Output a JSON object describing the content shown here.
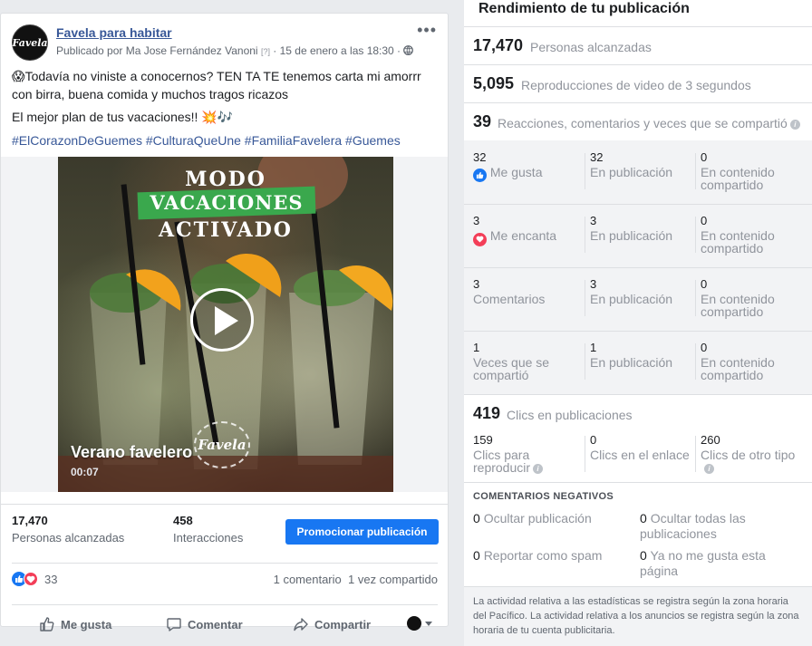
{
  "post": {
    "page_name": "Favela para habitar",
    "avatar_text": "Favela",
    "published_by": "Publicado por Ma Jose Fernández Vanoni",
    "help_marker": "[?]",
    "date": "· 15 de enero a las 18:30 ·",
    "line1": "Todavía no viniste a conocernos? TEN TA TE  tenemos carta mi amorrr con birra, buena comida y muchos tragos ricazos",
    "line2": "El mejor plan de tus vacaciones!! ",
    "hashtags": "#ElCorazonDeGuemes #CulturaQueUne #FamiliaFavelera #Guemes",
    "video": {
      "title_line1": "MODO",
      "title_line2": "VACACIONES",
      "title_line3": "ACTIVADO",
      "caption": "Verano favelero",
      "duration": "00:07",
      "logo_text": "Favela"
    },
    "stats": {
      "reach_value": "17,470",
      "reach_label": "Personas alcanzadas",
      "interactions_value": "458",
      "interactions_label": "Interacciones",
      "promote_label": "Promocionar publicación"
    },
    "reactions": {
      "count": "33",
      "comments": "1 comentario",
      "shares": "1 vez compartido"
    },
    "actions": {
      "like": "Me gusta",
      "comment": "Comentar",
      "share": "Compartir"
    }
  },
  "insights": {
    "title": "Rendimiento de tu publicación",
    "reach": {
      "value": "17,470",
      "label": "Personas alcanzadas"
    },
    "video_views": {
      "value": "5,095",
      "label": "Reproducciones de video de 3 segundos"
    },
    "engagement": {
      "value": "39",
      "label": "Reacciones, comentarios y veces que se compartió"
    },
    "rows": [
      {
        "c1v": "32",
        "c1l": "Me gusta",
        "c2v": "32",
        "c2l": "En publicación",
        "c3v": "0",
        "c3l": "En contenido compartido"
      },
      {
        "c1v": "3",
        "c1l": "Me encanta",
        "c2v": "3",
        "c2l": "En publicación",
        "c3v": "0",
        "c3l": "En contenido compartido"
      },
      {
        "c1v": "3",
        "c1l": "Comentarios",
        "c2v": "3",
        "c2l": "En publicación",
        "c3v": "0",
        "c3l": "En contenido compartido"
      },
      {
        "c1v": "1",
        "c1l": "Veces que se compartió",
        "c2v": "1",
        "c2l": "En publicación",
        "c3v": "0",
        "c3l": "En contenido compartido"
      }
    ],
    "clicks": {
      "value": "419",
      "label": "Clics en publicaciones"
    },
    "click_breakdown": {
      "play_value": "159",
      "play_label": "Clics para reproducir",
      "link_value": "0",
      "link_label": "Clics en el enlace",
      "other_value": "260",
      "other_label": "Clics de otro tipo"
    },
    "negative": {
      "title": "COMENTARIOS NEGATIVOS",
      "hide_post_value": "0",
      "hide_post_label": "Ocultar publicación",
      "hide_all_value": "0",
      "hide_all_label": "Ocultar todas las publicaciones",
      "spam_value": "0",
      "spam_label": "Reportar como spam",
      "unlike_value": "0",
      "unlike_label": "Ya no me gusta esta página"
    },
    "footnote": "La actividad relativa a las estadísticas se registra según la zona horaria del Pacífico. La actividad relativa a los anuncios se registra según la zona horaria de tu cuenta publicitaria."
  },
  "colors": {
    "brand_blue": "#1877f2",
    "link_blue": "#385898",
    "love_red": "#f33e58",
    "banner_green": "#3aa84d"
  },
  "icons": [
    "more-options-icon",
    "globe-icon",
    "play-icon",
    "like-reaction-icon",
    "love-reaction-icon",
    "like-icon",
    "comment-icon",
    "share-icon",
    "info-icon"
  ]
}
